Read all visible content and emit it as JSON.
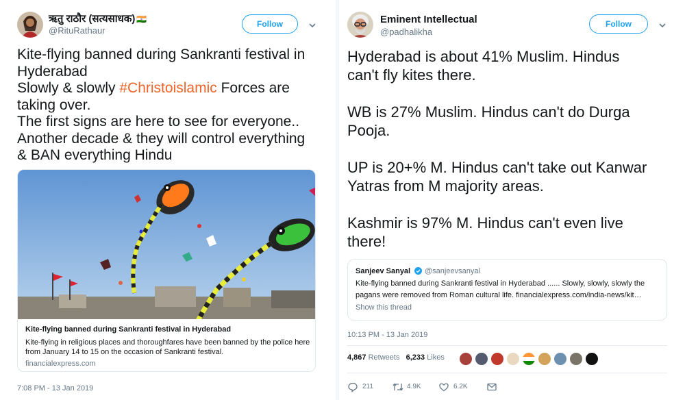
{
  "left_tweet": {
    "author_name": "ऋतु राठौर (सत्यसाधक)",
    "author_flag": "🇮🇳",
    "author_handle": "@RituRathaur",
    "follow_label": "Follow",
    "text_lines": [
      "Kite-flying banned during Sankranti festival in",
      "Hyderabad",
      "Slowly & slowly ",
      "Forces are",
      "taking over.",
      "The first signs are here to see for everyone..",
      "Another decade & they will control everything",
      "& BAN everything Hindu"
    ],
    "hashtag": "#Christoislamic",
    "card": {
      "title": "Kite-flying banned during Sankranti festival in Hyderabad",
      "description": "Kite-flying in religious places and thoroughfares have been banned by the police here from January 14 to 15 on the occasion of Sankranti festival.",
      "domain": "financialexpress.com"
    },
    "timestamp": "7:08 PM - 13 Jan 2019"
  },
  "right_tweet": {
    "author_name": "Eminent Intellectual",
    "author_handle": "@padhalikha",
    "follow_label": "Follow",
    "paragraphs": [
      [
        "Hyderabad is about 41% Muslim. Hindus",
        "can't fly kites there."
      ],
      [
        "WB is 27% Muslim. Hindus can't do Durga",
        "Pooja."
      ],
      [
        "UP is 20+% M. Hindus can't take out Kanwar",
        "Yatras from M majority areas."
      ],
      [
        "Kashmir is 97% M. Hindus can't even live",
        "there!"
      ]
    ],
    "quote": {
      "name": "Sanjeev Sanyal",
      "handle": "@sanjeevsanyal",
      "text": "Kite-flying banned during Sankranti festival in Hyderabad ...... Slowly, slowly, slowly the pagans were removed from Roman cultural life.  financialexpress.com/india-news/kit…",
      "show_thread": "Show this thread"
    },
    "timestamp": "10:13 PM - 13 Jan 2019",
    "retweets_count": "4,867",
    "retweets_label": "Retweets",
    "likes_count": "6,233",
    "likes_label": "Likes",
    "actions": {
      "replies": "211",
      "retweets": "4.9K",
      "likes": "6.2K"
    }
  },
  "colors": {
    "twitter_blue": "#1da1f2",
    "hashtag": "#f0642a",
    "muted": "#657786",
    "border": "#e1e8ed"
  },
  "icons": [
    "chevron-down-icon",
    "verified-icon",
    "reply-icon",
    "retweet-icon",
    "like-icon",
    "dm-icon"
  ]
}
